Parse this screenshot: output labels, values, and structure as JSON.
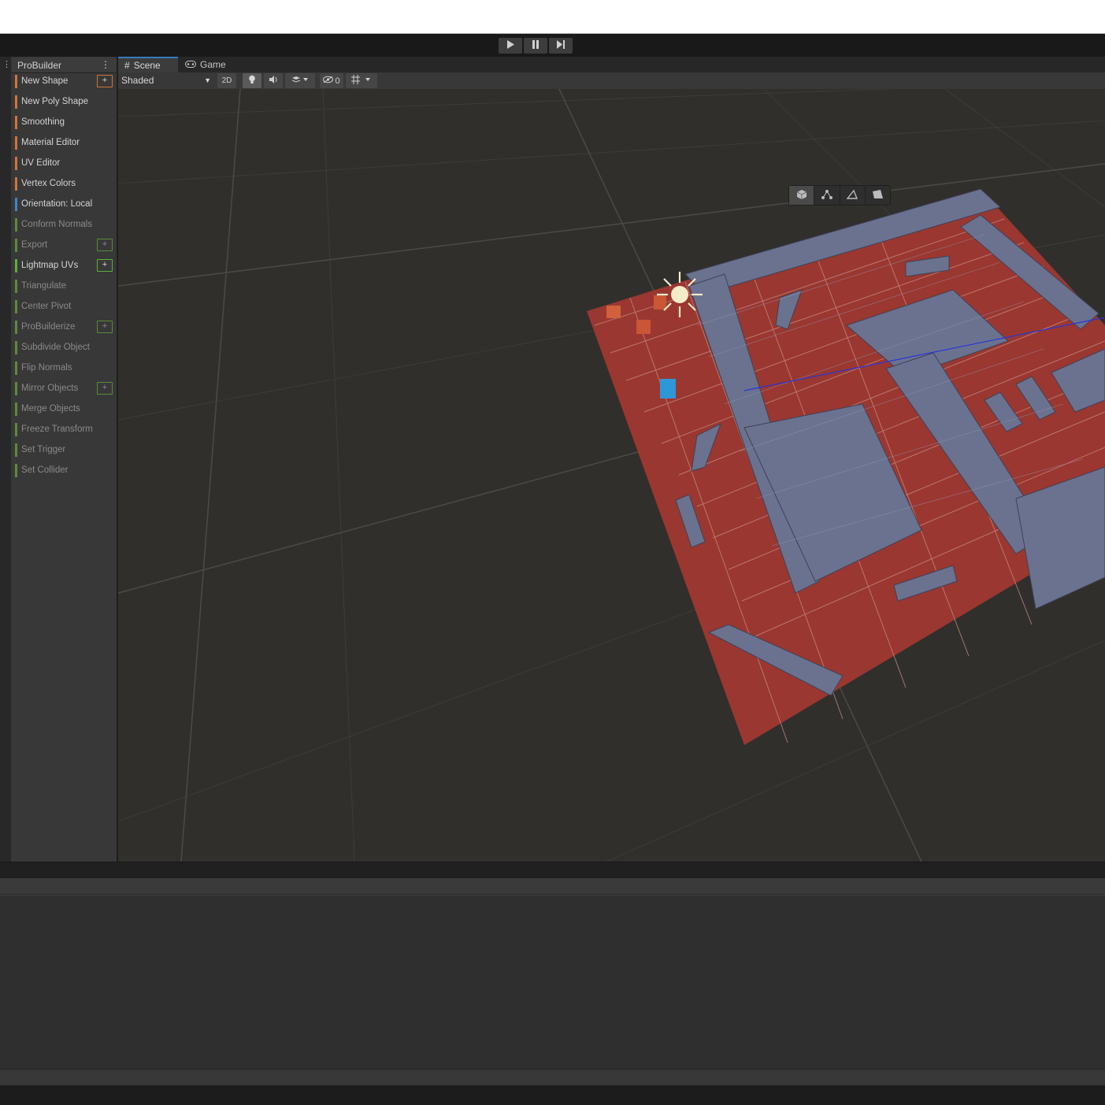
{
  "playbar": {
    "play": "play-icon",
    "pause": "pause-icon",
    "step": "step-icon"
  },
  "probuilder": {
    "title": "ProBuilder",
    "menu_icon": "kebab-menu-icon",
    "items": [
      {
        "label": "New Shape",
        "color": "#d0743a",
        "plus": true,
        "dim": false
      },
      {
        "label": "New Poly Shape",
        "color": "#d0743a",
        "plus": false,
        "dim": false
      },
      {
        "label": "Smoothing",
        "color": "#d0743a",
        "plus": false,
        "dim": false
      },
      {
        "label": "Material Editor",
        "color": "#d0743a",
        "plus": false,
        "dim": false
      },
      {
        "label": "UV Editor",
        "color": "#d0743a",
        "plus": false,
        "dim": false
      },
      {
        "label": "Vertex Colors",
        "color": "#d0743a",
        "plus": false,
        "dim": false
      },
      {
        "label": "Orientation: Local",
        "color": "#3d86c6",
        "plus": false,
        "dim": false
      },
      {
        "label": "Conform Normals",
        "color": "#5d8a3a",
        "plus": false,
        "dim": true
      },
      {
        "label": "Export",
        "color": "#5d8a3a",
        "plus": true,
        "dim": true
      },
      {
        "label": "Lightmap UVs",
        "color": "#5dae36",
        "plus": true,
        "dim": false
      },
      {
        "label": "Triangulate",
        "color": "#5d8a3a",
        "plus": false,
        "dim": true
      },
      {
        "label": "Center Pivot",
        "color": "#5d8a3a",
        "plus": false,
        "dim": true
      },
      {
        "label": "ProBuilderize",
        "color": "#5d8a3a",
        "plus": true,
        "dim": true
      },
      {
        "label": "Subdivide Object",
        "color": "#5d8a3a",
        "plus": false,
        "dim": true
      },
      {
        "label": "Flip Normals",
        "color": "#5d8a3a",
        "plus": false,
        "dim": true
      },
      {
        "label": "Mirror Objects",
        "color": "#5d8a3a",
        "plus": true,
        "dim": true
      },
      {
        "label": "Merge Objects",
        "color": "#5d8a3a",
        "plus": false,
        "dim": true
      },
      {
        "label": "Freeze Transform",
        "color": "#5d8a3a",
        "plus": false,
        "dim": true
      },
      {
        "label": "Set Trigger",
        "color": "#5d8a3a",
        "plus": false,
        "dim": true
      },
      {
        "label": "Set Collider",
        "color": "#5d8a3a",
        "plus": false,
        "dim": true
      }
    ]
  },
  "tabs": {
    "scene": "Scene",
    "game": "Game"
  },
  "toolbar": {
    "shading": "Shaded",
    "twod": "2D",
    "hidden_count": "0"
  },
  "colors": {
    "floor": "#9a3730",
    "wall": "#6b7290",
    "accent": "#3a79bb"
  }
}
